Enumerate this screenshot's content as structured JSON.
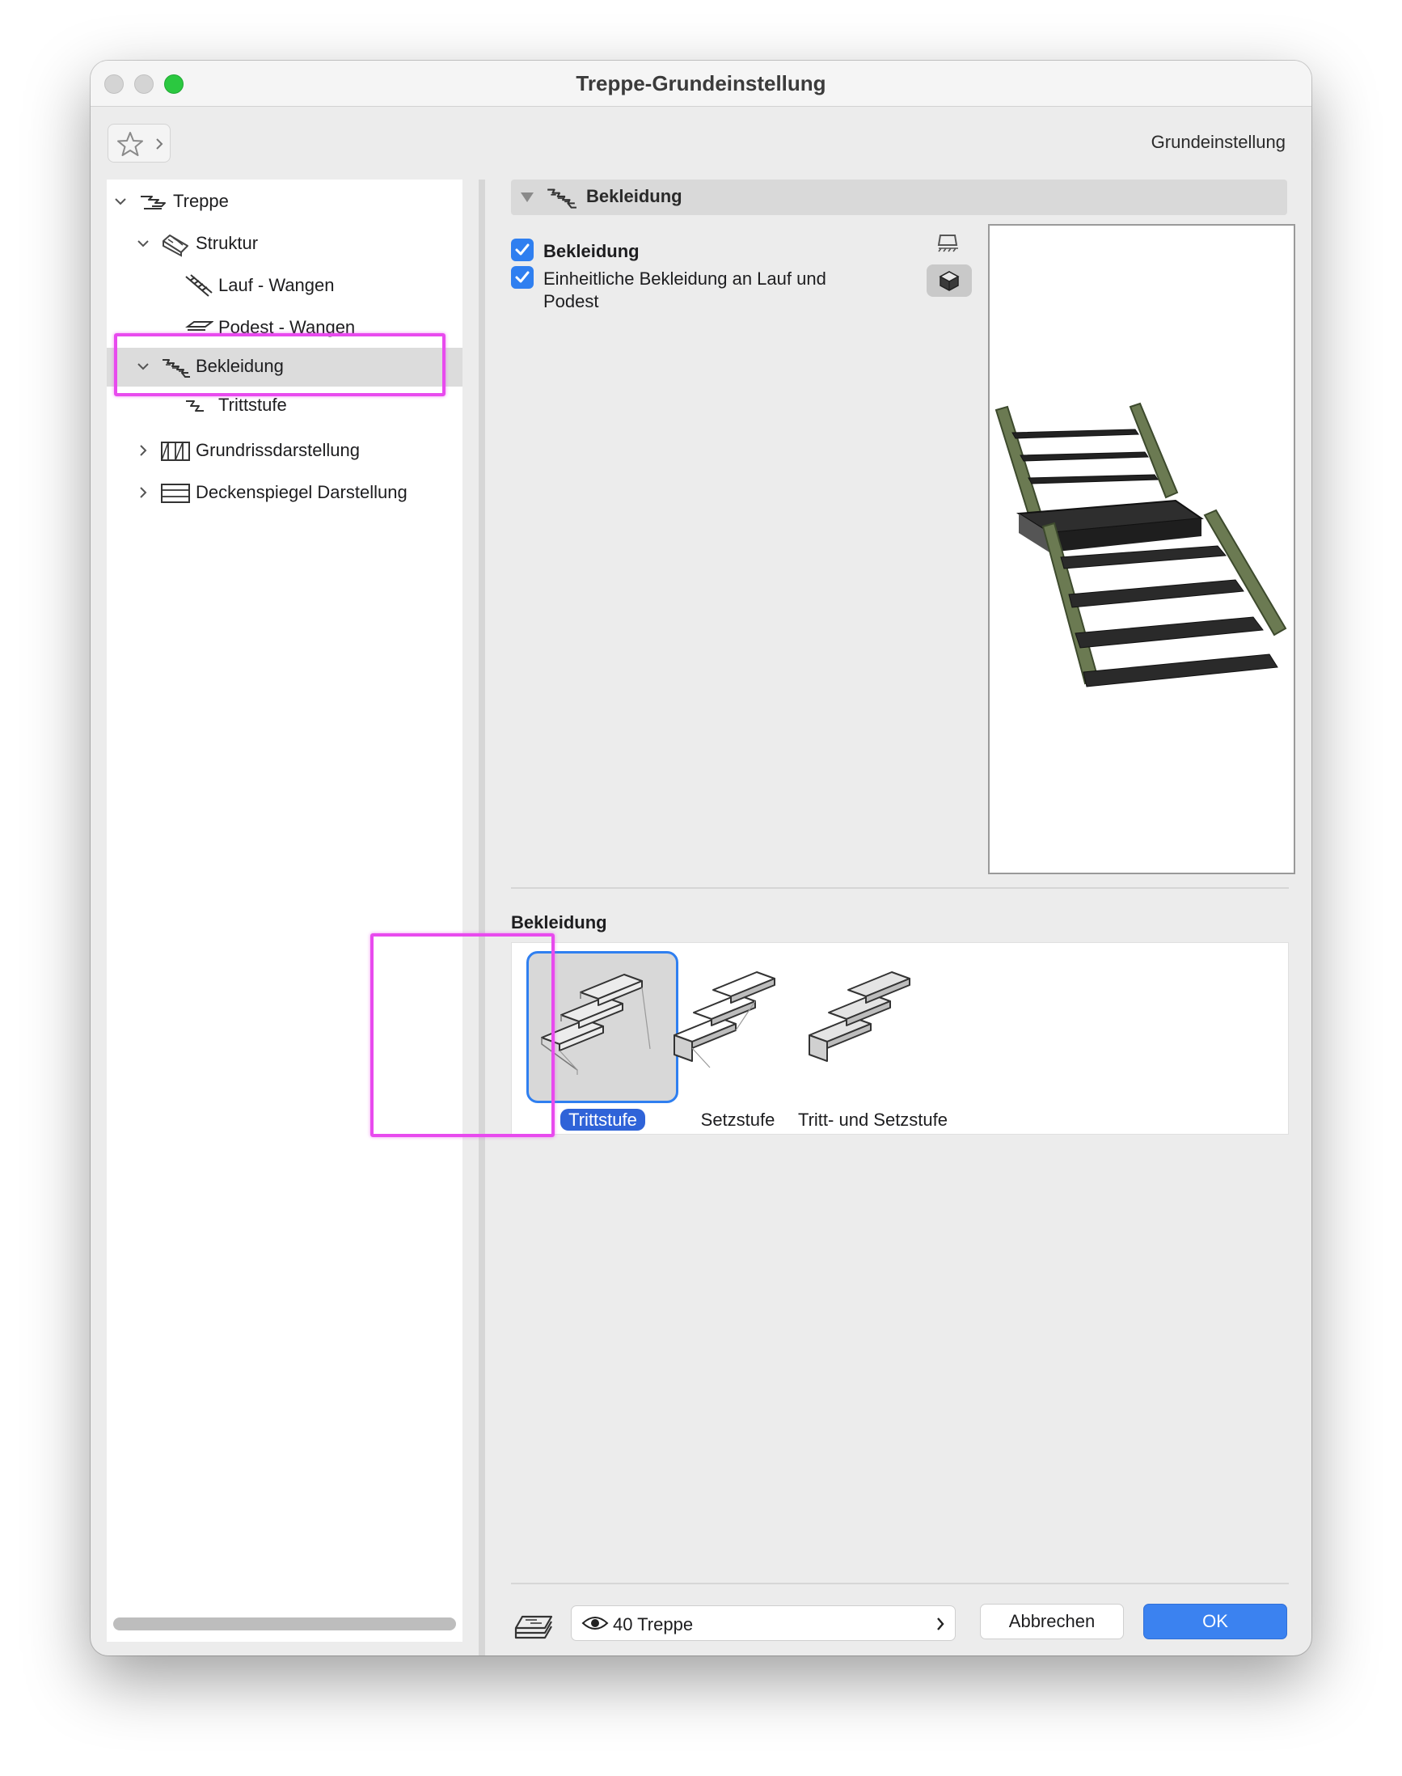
{
  "window": {
    "title": "Treppe-Grundeinstellung",
    "preset_label": "Grundeinstellung"
  },
  "tree": {
    "items": [
      {
        "label": "Treppe",
        "icon": "stair-icon",
        "disclosure": "expanded"
      },
      {
        "label": "Struktur",
        "icon": "structure-icon",
        "disclosure": "expanded"
      },
      {
        "label": "Lauf - Wangen",
        "icon": "flight-stringers-icon",
        "disclosure": "none"
      },
      {
        "label": "Podest - Wangen",
        "icon": "landing-stringers-icon",
        "disclosure": "none"
      },
      {
        "label": "Bekleidung",
        "icon": "finish-icon",
        "disclosure": "expanded",
        "selected": true
      },
      {
        "label": "Trittstufe",
        "icon": "tread-icon",
        "disclosure": "none"
      },
      {
        "label": "Grundrissdarstellung",
        "icon": "floor-plan-icon",
        "disclosure": "collapsed"
      },
      {
        "label": "Deckenspiegel Darstellung",
        "icon": "ceiling-plan-icon",
        "disclosure": "collapsed"
      }
    ]
  },
  "panel": {
    "section_title": "Bekleidung",
    "checkbox_finish": {
      "label": "Bekleidung",
      "checked": true
    },
    "checkbox_uniform": {
      "label_line1": "Einheitliche Bekleidung an Lauf und",
      "label_line2": "Podest",
      "checked": true
    },
    "group_label": "Bekleidung",
    "options": [
      {
        "label": "Trittstufe",
        "selected": true
      },
      {
        "label": "Setzstufe",
        "selected": false
      },
      {
        "label": "Tritt- und Setzstufe",
        "selected": false
      }
    ]
  },
  "footer": {
    "layer_value": "40 Treppe",
    "cancel_label": "Abbrechen",
    "ok_label": "OK"
  },
  "colors": {
    "accent": "#2f7ff0",
    "highlight": "#e84aee",
    "traffic_green": "#2bc840",
    "stringer": "#6b7a52",
    "tread": "#2a2a2a"
  }
}
